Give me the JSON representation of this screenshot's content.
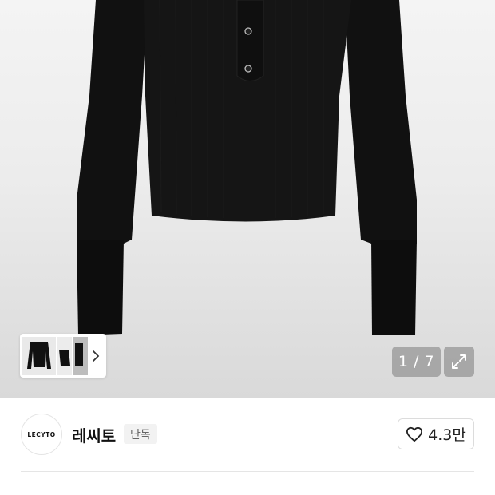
{
  "gallery": {
    "counter": "1 / 7",
    "thumbnails": [
      "product-front",
      "product-folded",
      "product-detail"
    ],
    "icons": {
      "next": "chevron-right-icon",
      "expand": "expand-icon"
    }
  },
  "brand": {
    "logo_text": "LECYTO",
    "name": "레씨토",
    "badge": "단독"
  },
  "like": {
    "icon": "heart-icon",
    "count": "4.3만"
  }
}
